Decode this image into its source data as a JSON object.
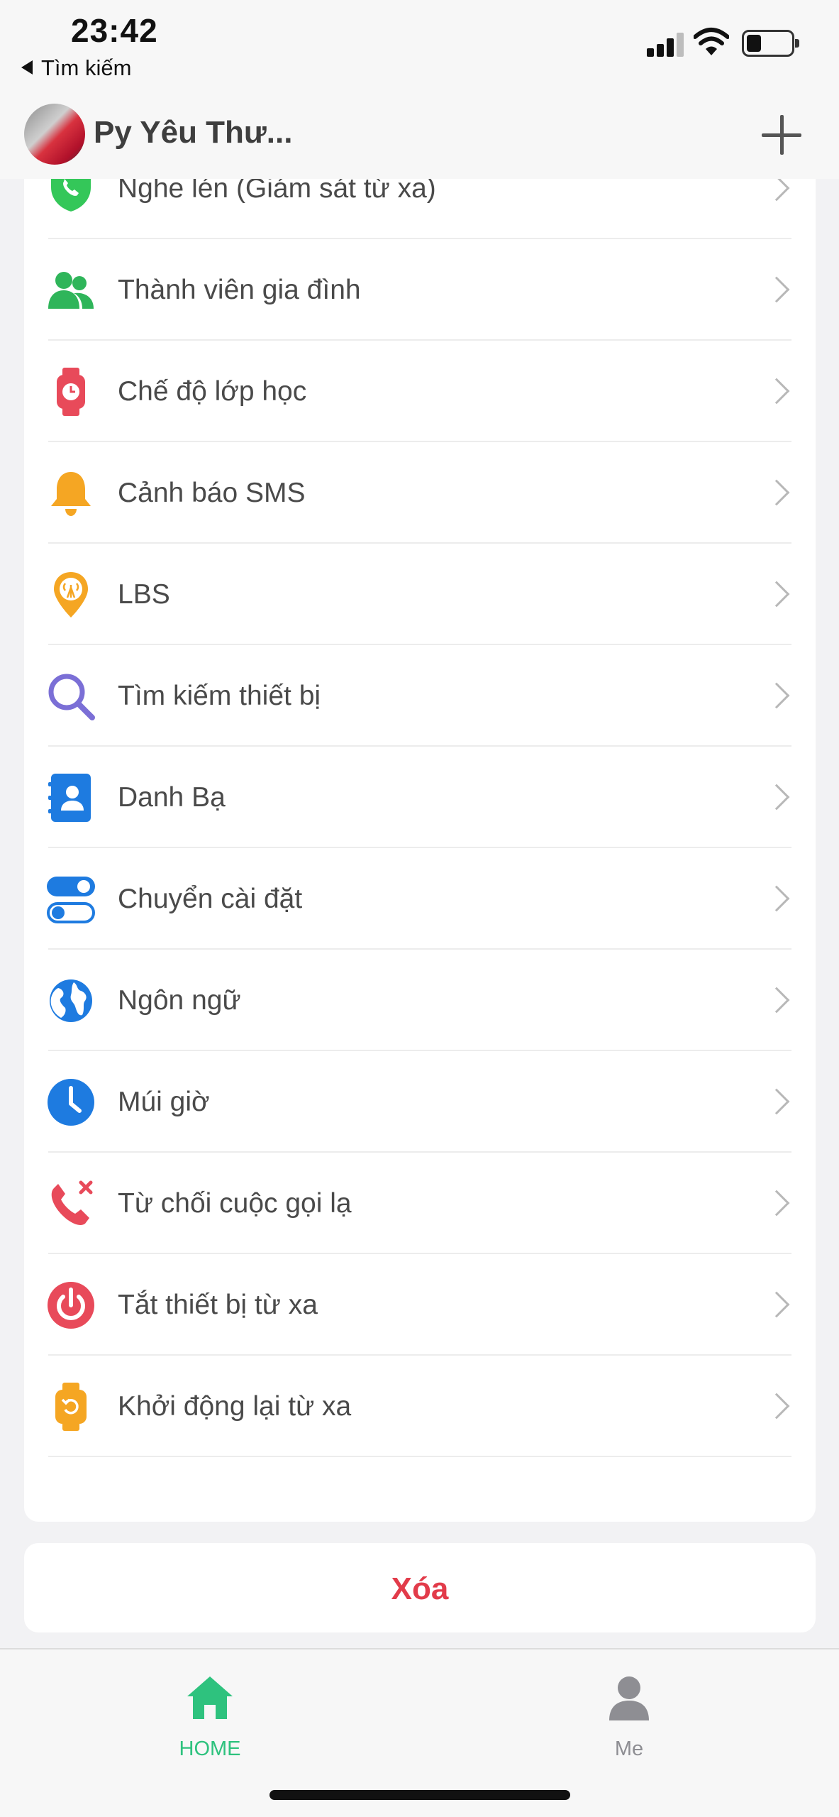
{
  "status_bar": {
    "time": "23:42",
    "back_label": "Tìm kiếm"
  },
  "header": {
    "device_name": "Py Yêu Thư..."
  },
  "settings": {
    "items": [
      {
        "label": "Nghe lén (Giám sát từ xa)",
        "icon": "shield-phone-icon",
        "color": "#34c759"
      },
      {
        "label": "Thành viên gia đình",
        "icon": "family-members-icon",
        "color": "#2fb55a"
      },
      {
        "label": "Chế độ lớp học",
        "icon": "watch-icon",
        "color": "#e84a5a"
      },
      {
        "label": "Cảnh báo SMS",
        "icon": "bell-icon",
        "color": "#f5a623"
      },
      {
        "label": "LBS",
        "icon": "location-tower-icon",
        "color": "#f5a623"
      },
      {
        "label": "Tìm kiếm thiết bị",
        "icon": "search-icon",
        "color": "#7b6fd6"
      },
      {
        "label": "Danh Bạ",
        "icon": "contacts-book-icon",
        "color": "#1e7be0"
      },
      {
        "label": "Chuyển cài đặt",
        "icon": "toggle-switches-icon",
        "color": "#1e7be0"
      },
      {
        "label": "Ngôn ngữ",
        "icon": "globe-icon",
        "color": "#1e7be0"
      },
      {
        "label": "Múi giờ",
        "icon": "clock-icon",
        "color": "#1e7be0"
      },
      {
        "label": "Từ chối cuộc gọi lạ",
        "icon": "reject-call-icon",
        "color": "#e84a5a"
      },
      {
        "label": "Tắt thiết bị từ xa",
        "icon": "power-icon",
        "color": "#e84a5a"
      },
      {
        "label": "Khởi động lại từ xa",
        "icon": "watch-restart-icon",
        "color": "#f5a623"
      }
    ]
  },
  "delete": {
    "label": "Xóa",
    "color": "#e23b4a"
  },
  "tabbar": {
    "home_label": "HOME",
    "me_label": "Me",
    "active_color": "#2ec27e",
    "inactive_color": "#8e8e93"
  }
}
